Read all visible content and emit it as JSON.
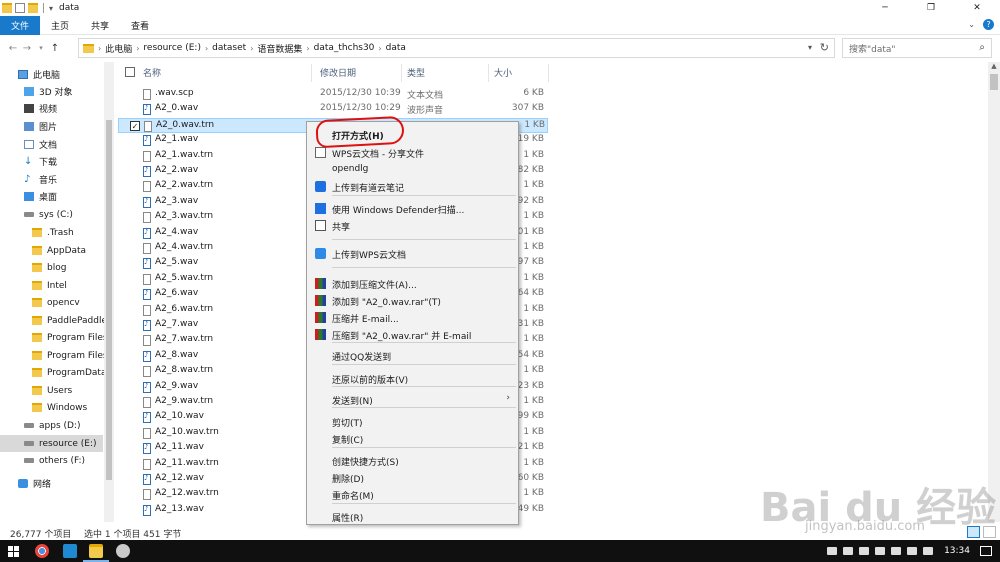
{
  "window": {
    "title": "data"
  },
  "ribbon": {
    "tabs": [
      "文件",
      "主页",
      "共享",
      "查看"
    ]
  },
  "address": {
    "crumbs": [
      "此电脑",
      "resource (E:)",
      "dataset",
      "语音数据集",
      "data_thchs30",
      "data"
    ],
    "search_placeholder": "搜索\"data\""
  },
  "sidebar": {
    "items": [
      {
        "label": "此电脑",
        "icon": "pc-icon"
      },
      {
        "label": "3D 对象",
        "icon": "3d-objects-icon"
      },
      {
        "label": "视频",
        "icon": "video-icon"
      },
      {
        "label": "图片",
        "icon": "pictures-icon"
      },
      {
        "label": "文档",
        "icon": "documents-icon"
      },
      {
        "label": "下载",
        "icon": "download-icon"
      },
      {
        "label": "音乐",
        "icon": "music-icon"
      },
      {
        "label": "桌面",
        "icon": "desktop-icon"
      },
      {
        "label": "sys (C:)",
        "icon": "drive-icon"
      },
      {
        "label": ".Trash",
        "icon": "folder-icon"
      },
      {
        "label": "AppData",
        "icon": "folder-icon"
      },
      {
        "label": "blog",
        "icon": "folder-icon"
      },
      {
        "label": "Intel",
        "icon": "folder-icon"
      },
      {
        "label": "opencv",
        "icon": "folder-icon"
      },
      {
        "label": "PaddlePaddle",
        "icon": "folder-icon"
      },
      {
        "label": "Program Files",
        "icon": "folder-icon"
      },
      {
        "label": "Program Files",
        "icon": "folder-icon"
      },
      {
        "label": "ProgramData",
        "icon": "folder-icon"
      },
      {
        "label": "Users",
        "icon": "folder-icon"
      },
      {
        "label": "Windows",
        "icon": "folder-icon"
      },
      {
        "label": "apps (D:)",
        "icon": "drive-icon"
      },
      {
        "label": "resource (E:)",
        "icon": "drive-icon"
      },
      {
        "label": "others (F:)",
        "icon": "drive-icon"
      },
      {
        "label": "网络",
        "icon": "network-icon"
      }
    ]
  },
  "columns": {
    "name": "名称",
    "date": "修改日期",
    "type": "类型",
    "size": "大小"
  },
  "files": [
    {
      "name": ".wav.scp",
      "date": "2015/12/30 10:39",
      "type": "文本文档",
      "size": "6 KB"
    },
    {
      "name": "A2_0.wav",
      "date": "2015/12/30 10:29",
      "type": "波形声音",
      "size": "307 KB"
    },
    {
      "name": "A2_0.wav.trn",
      "date": "",
      "type": "",
      "size": "1 KB"
    },
    {
      "name": "A2_1.wav",
      "date": "",
      "type": "",
      "size": "19 KB"
    },
    {
      "name": "A2_1.wav.trn",
      "date": "",
      "type": "",
      "size": "1 KB"
    },
    {
      "name": "A2_2.wav",
      "date": "",
      "type": "",
      "size": "82 KB"
    },
    {
      "name": "A2_2.wav.trn",
      "date": "",
      "type": "",
      "size": "1 KB"
    },
    {
      "name": "A2_3.wav",
      "date": "",
      "type": "",
      "size": "92 KB"
    },
    {
      "name": "A2_3.wav.trn",
      "date": "",
      "type": "",
      "size": "1 KB"
    },
    {
      "name": "A2_4.wav",
      "date": "",
      "type": "",
      "size": "01 KB"
    },
    {
      "name": "A2_4.wav.trn",
      "date": "",
      "type": "",
      "size": "1 KB"
    },
    {
      "name": "A2_5.wav",
      "date": "",
      "type": "",
      "size": "97 KB"
    },
    {
      "name": "A2_5.wav.trn",
      "date": "",
      "type": "",
      "size": "1 KB"
    },
    {
      "name": "A2_6.wav",
      "date": "",
      "type": "",
      "size": "64 KB"
    },
    {
      "name": "A2_6.wav.trn",
      "date": "",
      "type": "",
      "size": "1 KB"
    },
    {
      "name": "A2_7.wav",
      "date": "",
      "type": "",
      "size": "31 KB"
    },
    {
      "name": "A2_7.wav.trn",
      "date": "",
      "type": "",
      "size": "1 KB"
    },
    {
      "name": "A2_8.wav",
      "date": "",
      "type": "",
      "size": "54 KB"
    },
    {
      "name": "A2_8.wav.trn",
      "date": "",
      "type": "",
      "size": "1 KB"
    },
    {
      "name": "A2_9.wav",
      "date": "",
      "type": "",
      "size": "23 KB"
    },
    {
      "name": "A2_9.wav.trn",
      "date": "",
      "type": "",
      "size": "1 KB"
    },
    {
      "name": "A2_10.wav",
      "date": "",
      "type": "",
      "size": "99 KB"
    },
    {
      "name": "A2_10.wav.trn",
      "date": "",
      "type": "",
      "size": "1 KB"
    },
    {
      "name": "A2_11.wav",
      "date": "",
      "type": "",
      "size": "21 KB"
    },
    {
      "name": "A2_11.wav.trn",
      "date": "",
      "type": "",
      "size": "1 KB"
    },
    {
      "name": "A2_12.wav",
      "date": "",
      "type": "",
      "size": "60 KB"
    },
    {
      "name": "A2_12.wav.trn",
      "date": "",
      "type": "",
      "size": "1 KB"
    },
    {
      "name": "A2_13.wav",
      "date": "",
      "type": "",
      "size": "49 KB"
    }
  ],
  "context_menu": {
    "items": [
      {
        "label": "打开方式(H)",
        "icon": "",
        "bold": true
      },
      {
        "label": "WPS云文档 - 分享文件",
        "icon": "wps-share-icon"
      },
      {
        "label": "opendlg",
        "icon": ""
      },
      {
        "label": "上传到有道云笔记",
        "icon": "youdao-note-icon"
      },
      {
        "label": "使用 Windows Defender扫描...",
        "icon": "windows-defender-icon"
      },
      {
        "label": "共享",
        "icon": "share-icon"
      },
      {
        "label": "上传到WPS云文档",
        "icon": "wps-cloud-icon"
      },
      {
        "label": "添加到压缩文件(A)...",
        "icon": "winrar-icon"
      },
      {
        "label": "添加到 \"A2_0.wav.rar\"(T)",
        "icon": "winrar-icon"
      },
      {
        "label": "压缩并 E-mail...",
        "icon": "winrar-icon"
      },
      {
        "label": "压缩到 \"A2_0.wav.rar\" 并 E-mail",
        "icon": "winrar-icon"
      },
      {
        "label": "通过QQ发送到",
        "icon": ""
      },
      {
        "label": "还原以前的版本(V)",
        "icon": ""
      },
      {
        "label": "发送到(N)",
        "icon": "",
        "submenu": true
      },
      {
        "label": "剪切(T)",
        "icon": ""
      },
      {
        "label": "复制(C)",
        "icon": ""
      },
      {
        "label": "创建快捷方式(S)",
        "icon": ""
      },
      {
        "label": "删除(D)",
        "icon": ""
      },
      {
        "label": "重命名(M)",
        "icon": ""
      },
      {
        "label": "属性(R)",
        "icon": ""
      }
    ]
  },
  "status": {
    "count": "26,777 个项目",
    "selected": "选中 1 个项目  451 字节"
  },
  "taskbar": {
    "time": "13:34"
  },
  "watermark": {
    "brand": "Bai du 经验",
    "url": "jingyan.baidu.com"
  },
  "colors": {
    "accent": "#1979ca",
    "selection": "#cce8ff",
    "annotation": "#dd1111"
  }
}
